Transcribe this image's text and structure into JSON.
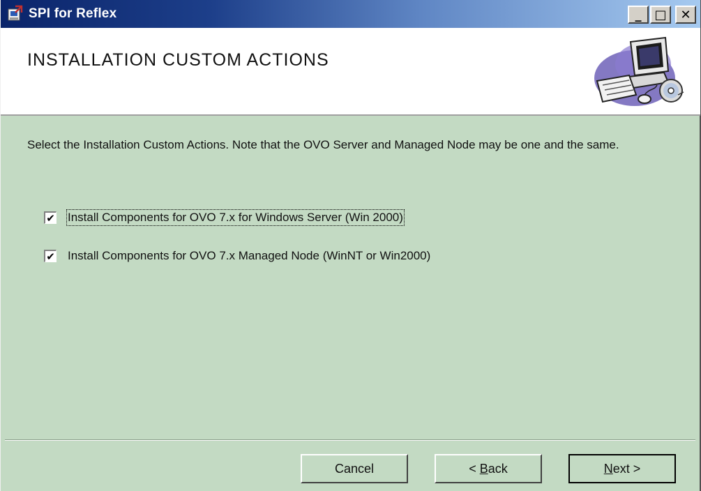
{
  "window": {
    "title": "SPI for Reflex",
    "controls": {
      "minimize": "_",
      "maximize": "□",
      "close": "✕"
    }
  },
  "header": {
    "title": "INSTALLATION CUSTOM ACTIONS",
    "graphic": "computer-with-cd-icon"
  },
  "body": {
    "description": "Select the Installation Custom Actions. Note that the OVO Server and Managed Node may be one and the same.",
    "options": [
      {
        "label": "Install Components for OVO 7.x for Windows Server (Win 2000)",
        "checked": true,
        "check_mark": "✔",
        "focused": true
      },
      {
        "label": "Install Components for OVO 7.x Managed Node (WinNT or Win2000)",
        "checked": true,
        "check_mark": "✔",
        "focused": false
      }
    ]
  },
  "footer": {
    "cancel": {
      "label": "Cancel"
    },
    "back": {
      "prefix": "< ",
      "mnemonic": "B",
      "rest": "ack"
    },
    "next": {
      "mnemonic": "N",
      "rest": "ext >"
    }
  },
  "colors": {
    "dialog_background": "#c3dac3",
    "title_bar_start": "#0a246a",
    "title_bar_end": "#a6caf0",
    "header_background": "#ffffff"
  }
}
